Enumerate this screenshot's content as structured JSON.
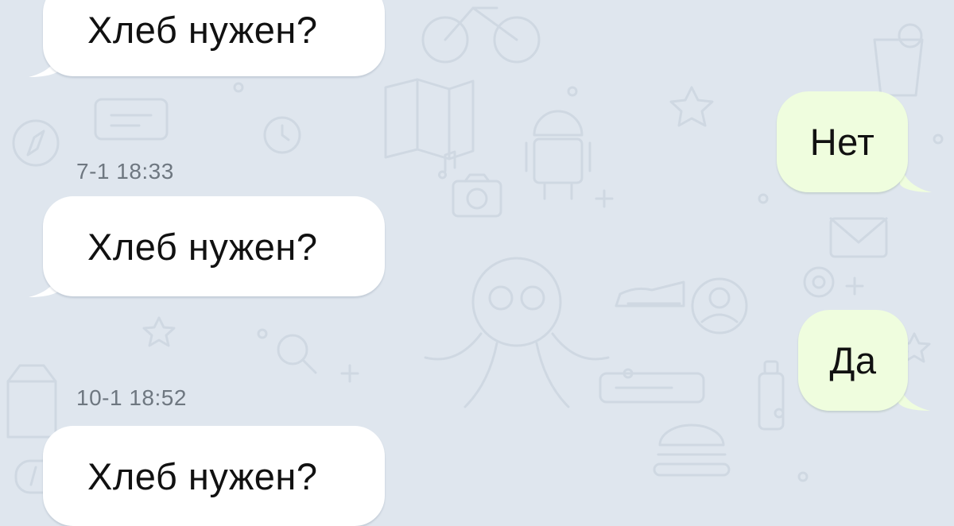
{
  "chat": {
    "messages": [
      {
        "direction": "incoming",
        "text": "Хлеб нужен?"
      },
      {
        "direction": "outgoing",
        "text": "Нет"
      },
      {
        "direction": "incoming",
        "timestamp": "7-1 18:33",
        "text": "Хлеб нужен?"
      },
      {
        "direction": "outgoing",
        "text": "Да"
      },
      {
        "direction": "incoming",
        "timestamp": "10-1 18:52",
        "text": "Хлеб нужен?"
      }
    ]
  },
  "colors": {
    "wallpaper": "#dfe6ee",
    "wallpaper_doodles": "#cfd8e2",
    "incoming_bubble": "#ffffff",
    "outgoing_bubble": "#effdde",
    "timestamp_text": "#6e7780"
  }
}
